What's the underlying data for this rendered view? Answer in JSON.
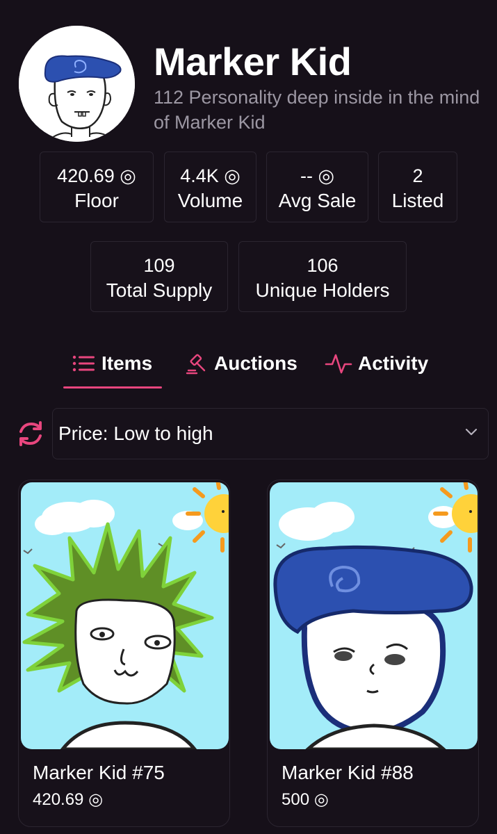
{
  "collection": {
    "name": "Marker Kid",
    "description": "112 Personality deep inside in the mind of Marker Kid"
  },
  "stats": [
    {
      "value": "420.69 ◎",
      "label": "Floor"
    },
    {
      "value": "4.4K ◎",
      "label": "Volume"
    },
    {
      "value": "-- ◎",
      "label": "Avg Sale"
    },
    {
      "value": "2",
      "label": "Listed"
    },
    {
      "value": "109",
      "label": "Total Supply"
    },
    {
      "value": "106",
      "label": "Unique Holders"
    }
  ],
  "tabs": [
    {
      "label": "Items",
      "icon": "list-icon",
      "active": true
    },
    {
      "label": "Auctions",
      "icon": "gavel-icon",
      "active": false
    },
    {
      "label": "Activity",
      "icon": "pulse-icon",
      "active": false
    }
  ],
  "sort": {
    "selected": "Price: Low to high",
    "refresh_icon": "refresh-icon",
    "chevron_icon": "chevron-down-icon"
  },
  "items": [
    {
      "name": "Marker Kid #75",
      "price": "420.69 ◎"
    },
    {
      "name": "Marker Kid #88",
      "price": "500 ◎"
    }
  ],
  "colors": {
    "background": "#161019",
    "accent": "#e8467e",
    "muted_text": "#9c97a3",
    "border": "#2b2530",
    "sky": "#a3ecf9"
  }
}
